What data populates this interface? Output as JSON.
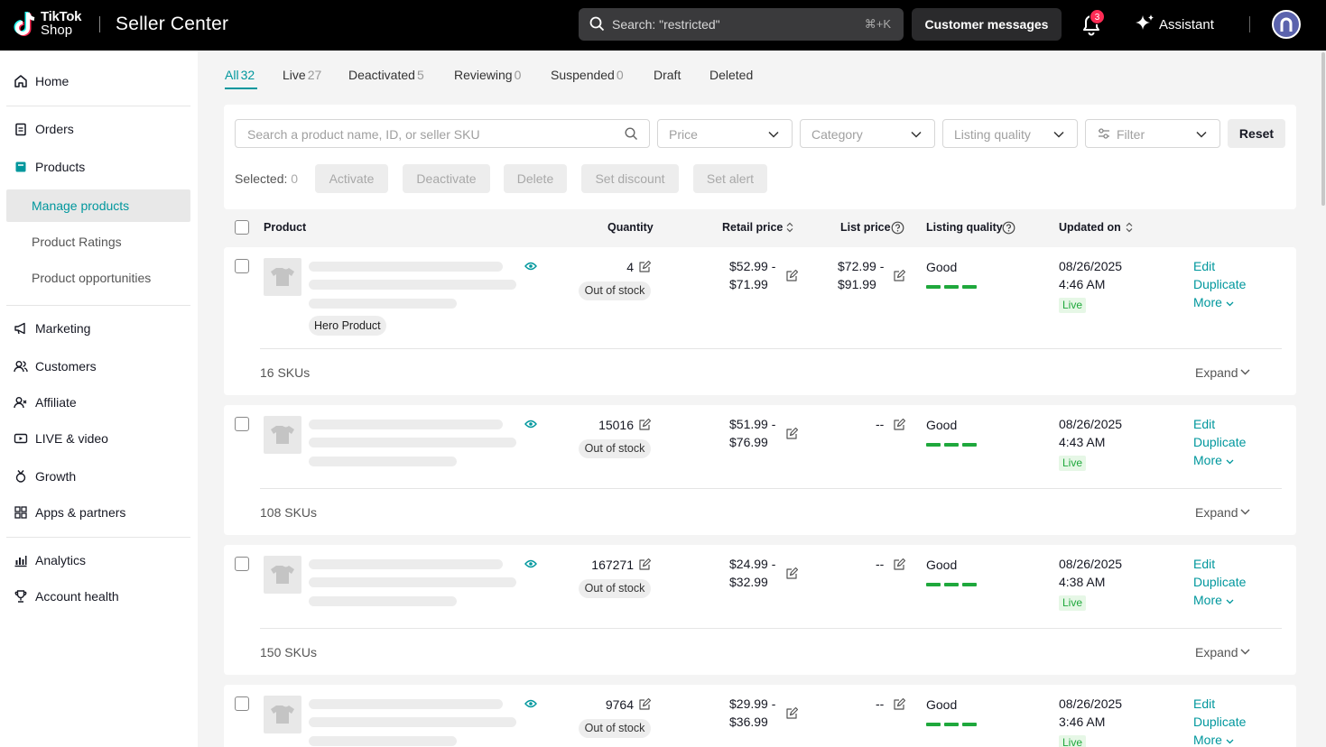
{
  "header": {
    "logo_line1": "TikTok",
    "logo_line2": "Shop",
    "brand": "Seller Center",
    "search_placeholder": "Search: \"restricted\"",
    "search_shortcut": "⌘+K",
    "customer_messages": "Customer messages",
    "notification_count": "3",
    "assistant": "Assistant"
  },
  "sidebar": {
    "home": "Home",
    "orders": "Orders",
    "products": "Products",
    "manage_products": "Manage products",
    "product_ratings": "Product Ratings",
    "product_opportunities": "Product opportunities",
    "marketing": "Marketing",
    "customers": "Customers",
    "affiliate": "Affiliate",
    "live_video": "LIVE & video",
    "growth": "Growth",
    "apps_partners": "Apps & partners",
    "analytics": "Analytics",
    "account_health": "Account health"
  },
  "tabs": [
    {
      "label": "All",
      "count": "32"
    },
    {
      "label": "Live",
      "count": "27"
    },
    {
      "label": "Deactivated",
      "count": "5"
    },
    {
      "label": "Reviewing",
      "count": "0"
    },
    {
      "label": "Suspended",
      "count": "0"
    },
    {
      "label": "Draft",
      "count": ""
    },
    {
      "label": "Deleted",
      "count": ""
    }
  ],
  "filters": {
    "search_placeholder": "Search a product name, ID, or seller SKU",
    "price": "Price",
    "category": "Category",
    "listing_quality": "Listing quality",
    "filter": "Filter",
    "reset": "Reset",
    "selected_label": "Selected:",
    "selected_count": "0",
    "activate": "Activate",
    "deactivate": "Deactivate",
    "delete": "Delete",
    "set_discount": "Set discount",
    "set_alert": "Set alert"
  },
  "table": {
    "col_product": "Product",
    "col_quantity": "Quantity",
    "col_retail": "Retail price",
    "col_list": "List price",
    "col_quality": "Listing quality",
    "col_updated": "Updated on"
  },
  "labels": {
    "hero_product": "Hero Product",
    "out_of_stock": "Out of stock",
    "edit": "Edit",
    "duplicate": "Duplicate",
    "more": "More",
    "expand": "Expand"
  },
  "products": [
    {
      "quantity": "4",
      "retail_1": "$52.99 -",
      "retail_2": "$71.99",
      "list_1": "$72.99 -",
      "list_2": "$91.99",
      "quality": "Good",
      "date": "08/26/2025",
      "time": "4:46 AM",
      "status": "Live",
      "skus": "16 SKUs"
    },
    {
      "quantity": "15016",
      "retail_1": "$51.99 -",
      "retail_2": "$76.99",
      "list_1": "--",
      "list_2": "",
      "quality": "Good",
      "date": "08/26/2025",
      "time": "4:43 AM",
      "status": "Live",
      "skus": "108 SKUs"
    },
    {
      "quantity": "167271",
      "retail_1": "$24.99 -",
      "retail_2": "$32.99",
      "list_1": "--",
      "list_2": "",
      "quality": "Good",
      "date": "08/26/2025",
      "time": "4:38 AM",
      "status": "Live",
      "skus": "150 SKUs"
    },
    {
      "quantity": "9764",
      "retail_1": "$29.99 -",
      "retail_2": "$36.99",
      "list_1": "--",
      "list_2": "",
      "quality": "Good",
      "date": "08/26/2025",
      "time": "3:46 AM",
      "status": "Live",
      "skus": ""
    }
  ]
}
